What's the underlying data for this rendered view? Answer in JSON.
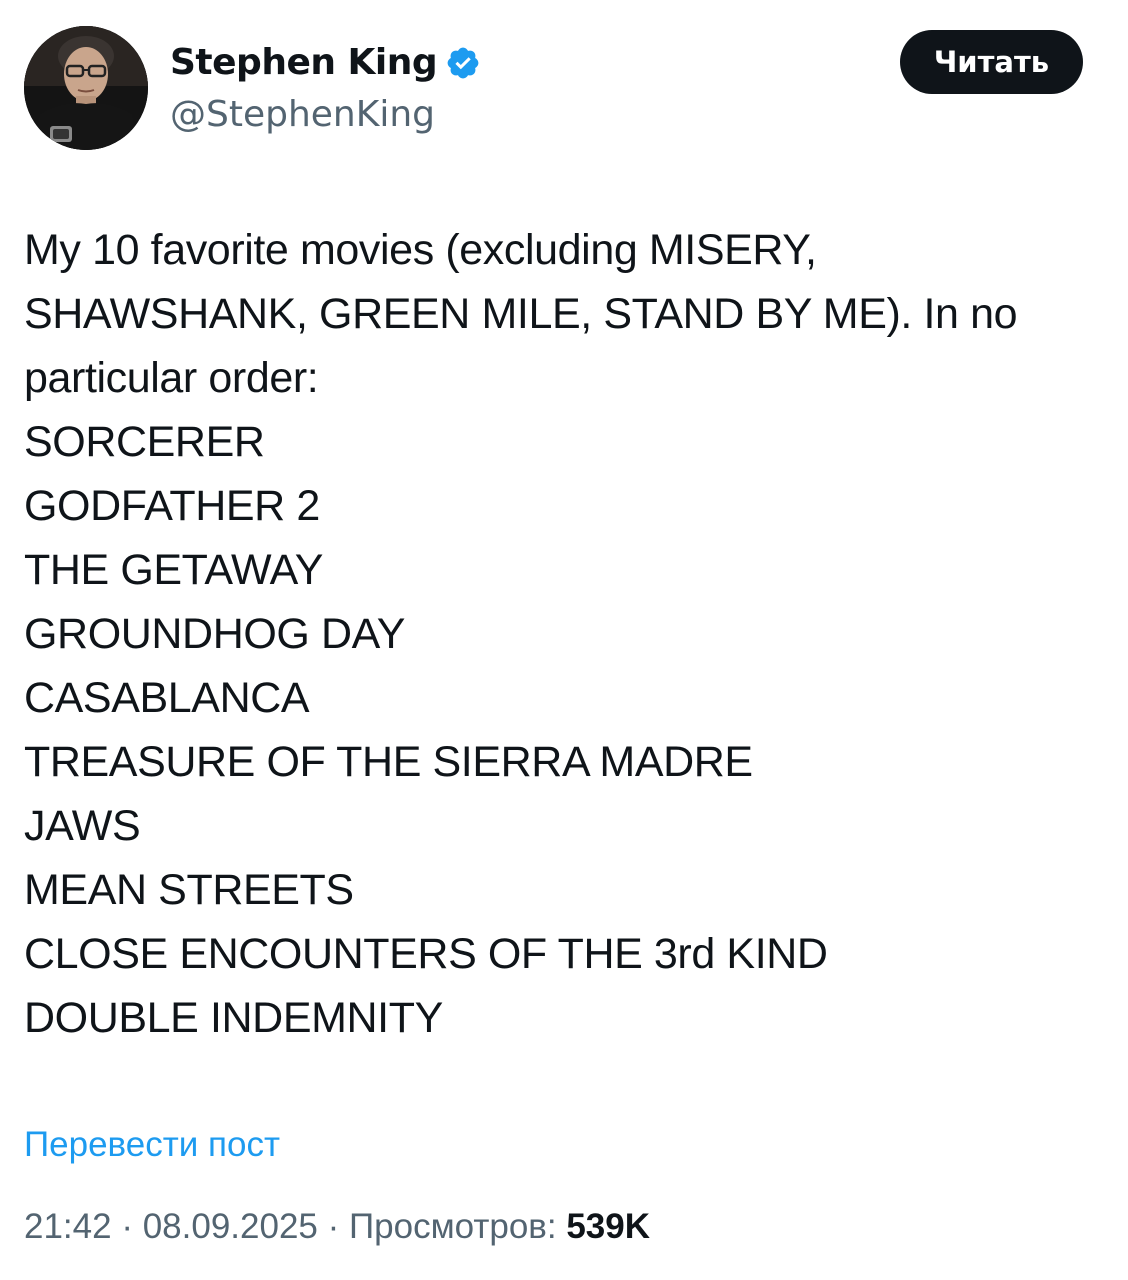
{
  "author": {
    "name": "Stephen King",
    "handle": "@StephenKing",
    "verified": true
  },
  "follow_button": {
    "label": "Читать"
  },
  "post": {
    "intro": "My 10 favorite movies (excluding MISERY, SHAWSHANK, GREEN MILE, STAND BY ME). In no particular order:",
    "movies": [
      "SORCERER",
      "GODFATHER 2",
      "THE GETAWAY",
      "GROUNDHOG DAY",
      "CASABLANCA",
      "TREASURE OF THE SIERRA MADRE",
      "JAWS",
      "MEAN STREETS",
      "CLOSE ENCOUNTERS OF THE 3rd KIND",
      "DOUBLE INDEMNITY"
    ]
  },
  "translate_label": "Перевести пост",
  "meta": {
    "time": "21:42",
    "separator": " · ",
    "date": "08.09.2025",
    "views_label": "Просмотров:",
    "views_count": "539K"
  },
  "colors": {
    "text": "#0f1419",
    "secondary": "#536471",
    "link": "#1d9bf0",
    "verified": "#1d9bf0",
    "button_bg": "#0f1419",
    "button_text": "#ffffff"
  }
}
